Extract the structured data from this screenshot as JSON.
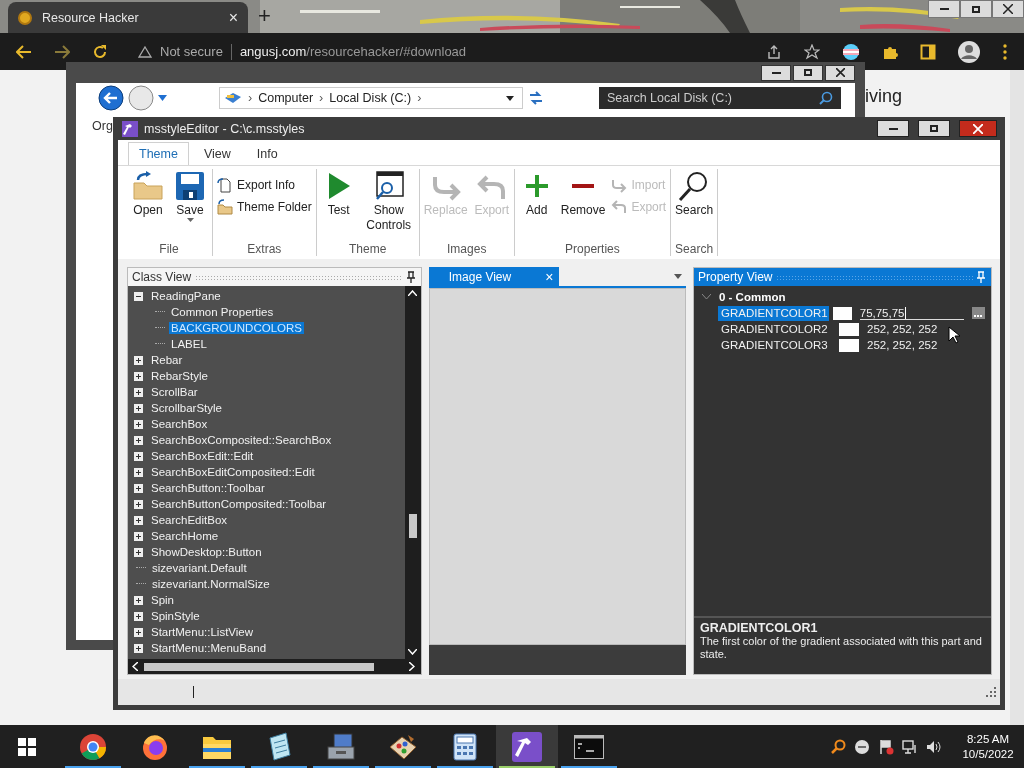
{
  "browser": {
    "tab_title": "Resource Hacker",
    "tab_close": "×",
    "new_tab": "+",
    "security": "Not secure",
    "url_host": "angusj.com",
    "url_path": "/resourcehacker/#download",
    "page_text": "iving"
  },
  "explorer": {
    "breadcrumb": [
      "Computer",
      "Local Disk (C:)"
    ],
    "crumb_separator": "›",
    "search_placeholder": "Search Local Disk (C:)",
    "toolbar_text": "Org"
  },
  "app": {
    "title": "msstyleEditor - C:\\c.msstyles",
    "ribbon_tabs": [
      {
        "label": "Theme",
        "selected": true
      },
      {
        "label": "View",
        "selected": false
      },
      {
        "label": "Info",
        "selected": false
      }
    ],
    "ribbon_groups": [
      {
        "label": "File",
        "items": [
          {
            "label": "Open",
            "kind": "large",
            "disabled": false
          },
          {
            "label": "Save",
            "kind": "large",
            "disabled": false,
            "dropdown": true
          }
        ]
      },
      {
        "label": "Extras",
        "items": [
          {
            "label": "Export Info",
            "kind": "small",
            "disabled": false
          },
          {
            "label": "Theme Folder",
            "kind": "small",
            "disabled": false
          }
        ]
      },
      {
        "label": "Theme",
        "items": [
          {
            "label": "Test",
            "kind": "large",
            "disabled": false
          },
          {
            "label": "Show Controls",
            "kind": "large",
            "disabled": false
          }
        ]
      },
      {
        "label": "Images",
        "items": [
          {
            "label": "Replace",
            "kind": "large",
            "disabled": true
          },
          {
            "label": "Export",
            "kind": "large",
            "disabled": true
          }
        ]
      },
      {
        "label": "Properties",
        "items": [
          {
            "label": "Add",
            "kind": "large",
            "disabled": false
          },
          {
            "label": "Remove",
            "kind": "large",
            "disabled": false
          },
          {
            "label": "Import",
            "kind": "small",
            "disabled": true
          },
          {
            "label": "Export",
            "kind": "small",
            "disabled": true
          }
        ]
      },
      {
        "label": "Search",
        "items": [
          {
            "label": "Search",
            "kind": "large",
            "disabled": false
          }
        ]
      }
    ],
    "class_view": {
      "title": "Class View",
      "items": [
        {
          "label": "ReadingPane",
          "kind": "group",
          "expanded": true,
          "selected": false,
          "children": [
            {
              "label": "Common Properties",
              "kind": "leaf",
              "selected": false
            },
            {
              "label": "BACKGROUNDCOLORS",
              "kind": "leaf",
              "selected": true
            },
            {
              "label": "LABEL",
              "kind": "leaf",
              "selected": false
            }
          ]
        },
        {
          "label": "Rebar",
          "kind": "group",
          "expanded": false,
          "selected": false
        },
        {
          "label": "RebarStyle",
          "kind": "group",
          "expanded": false,
          "selected": false
        },
        {
          "label": "ScrollBar",
          "kind": "group",
          "expanded": false,
          "selected": false
        },
        {
          "label": "ScrollbarStyle",
          "kind": "group",
          "expanded": false,
          "selected": false
        },
        {
          "label": "SearchBox",
          "kind": "group",
          "expanded": false,
          "selected": false
        },
        {
          "label": "SearchBoxComposited::SearchBox",
          "kind": "group",
          "expanded": false,
          "selected": false
        },
        {
          "label": "SearchBoxEdit::Edit",
          "kind": "group",
          "expanded": false,
          "selected": false
        },
        {
          "label": "SearchBoxEditComposited::Edit",
          "kind": "group",
          "expanded": false,
          "selected": false
        },
        {
          "label": "SearchButton::Toolbar",
          "kind": "group",
          "expanded": false,
          "selected": false
        },
        {
          "label": "SearchButtonComposited::Toolbar",
          "kind": "group",
          "expanded": false,
          "selected": false
        },
        {
          "label": "SearchEditBox",
          "kind": "group",
          "expanded": false,
          "selected": false
        },
        {
          "label": "SearchHome",
          "kind": "group",
          "expanded": false,
          "selected": false
        },
        {
          "label": "ShowDesktop::Button",
          "kind": "group",
          "expanded": false,
          "selected": false
        },
        {
          "label": "sizevariant.Default",
          "kind": "leaf",
          "selected": false
        },
        {
          "label": "sizevariant.NormalSize",
          "kind": "leaf",
          "selected": false
        },
        {
          "label": "Spin",
          "kind": "group",
          "expanded": false,
          "selected": false
        },
        {
          "label": "SpinStyle",
          "kind": "group",
          "expanded": false,
          "selected": false
        },
        {
          "label": "StartMenu::ListView",
          "kind": "group",
          "expanded": false,
          "selected": false
        },
        {
          "label": "StartMenu::MenuBand",
          "kind": "group",
          "expanded": false,
          "selected": false
        }
      ]
    },
    "image_view": {
      "tab_label": "Image View",
      "tab_close": "×"
    },
    "property_view": {
      "title": "Property View",
      "group": {
        "label": "0 - Common",
        "expanded": true
      },
      "rows": [
        {
          "name": "GRADIENTCOLOR1",
          "color": "#ffffff",
          "value": "75,75,75",
          "selected": true,
          "editing": true
        },
        {
          "name": "GRADIENTCOLOR2",
          "color": "#ffffff",
          "value": "252, 252, 252",
          "selected": false,
          "editing": false
        },
        {
          "name": "GRADIENTCOLOR3",
          "color": "#ffffff",
          "value": "252, 252, 252",
          "selected": false,
          "editing": false
        }
      ],
      "description": {
        "title": "GRADIENTCOLOR1",
        "text": "The first color of the gradient associated with this part and state."
      }
    }
  },
  "taskbar": {
    "apps": [
      {
        "running": true,
        "active": false
      },
      {
        "running": false,
        "active": false
      },
      {
        "running": true,
        "active": false
      },
      {
        "running": true,
        "active": false
      },
      {
        "running": true,
        "active": false
      },
      {
        "running": true,
        "active": false
      },
      {
        "running": true,
        "active": false
      },
      {
        "running": true,
        "active": true
      },
      {
        "running": true,
        "active": false
      }
    ],
    "time": "8:25 AM",
    "date": "10/5/2022"
  }
}
